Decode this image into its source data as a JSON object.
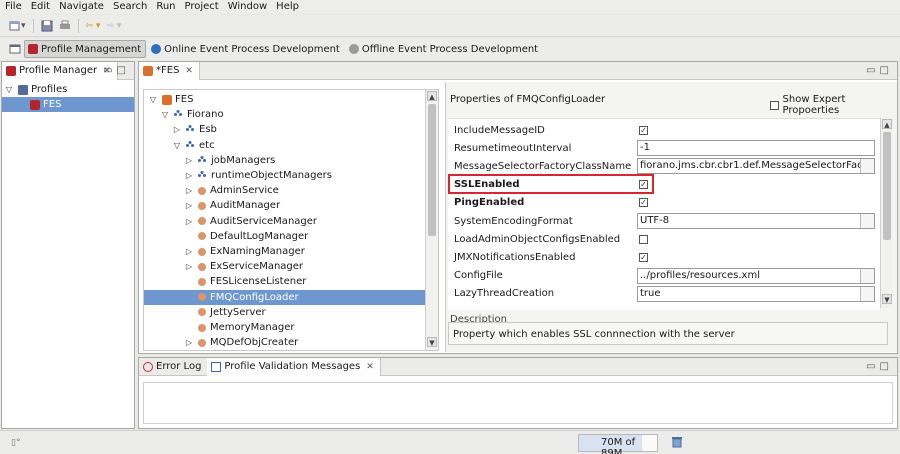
{
  "menu": [
    "File",
    "Edit",
    "Navigate",
    "Search",
    "Run",
    "Project",
    "Window",
    "Help"
  ],
  "perspectives": [
    {
      "label": "Profile Management",
      "active": true
    },
    {
      "label": "Online Event Process Development",
      "active": false
    },
    {
      "label": "Offline Event Process Development",
      "active": false
    }
  ],
  "profile_manager": {
    "tab_label": "Profile Manager",
    "tree": [
      {
        "label": "Profiles",
        "expanded": true
      },
      {
        "label": "FES",
        "selected": true
      }
    ]
  },
  "editor": {
    "tab_label": "*FES",
    "tree": [
      {
        "label": "FES",
        "depth": 0,
        "twisty": "open"
      },
      {
        "label": "Fiorano",
        "depth": 1,
        "twisty": "open"
      },
      {
        "label": "Esb",
        "depth": 2,
        "twisty": "closed"
      },
      {
        "label": "etc",
        "depth": 2,
        "twisty": "open"
      },
      {
        "label": "jobManagers",
        "depth": 3,
        "twisty": "closed",
        "icon": "pkg"
      },
      {
        "label": "runtimeObjectManagers",
        "depth": 3,
        "twisty": "closed",
        "icon": "pkg"
      },
      {
        "label": "AdminService",
        "depth": 3,
        "twisty": "closed",
        "icon": "dot"
      },
      {
        "label": "AuditManager",
        "depth": 3,
        "twisty": "closed",
        "icon": "dot"
      },
      {
        "label": "AuditServiceManager",
        "depth": 3,
        "twisty": "closed",
        "icon": "dot"
      },
      {
        "label": "DefaultLogManager",
        "depth": 3,
        "twisty": "none",
        "icon": "dot"
      },
      {
        "label": "ExNamingManager",
        "depth": 3,
        "twisty": "closed",
        "icon": "dot"
      },
      {
        "label": "ExServiceManager",
        "depth": 3,
        "twisty": "closed",
        "icon": "dot"
      },
      {
        "label": "FESLicenseListener",
        "depth": 3,
        "twisty": "none",
        "icon": "dot"
      },
      {
        "label": "FMQConfigLoader",
        "depth": 3,
        "twisty": "none",
        "icon": "dot",
        "selected": true
      },
      {
        "label": "JettyServer",
        "depth": 3,
        "twisty": "none",
        "icon": "dot"
      },
      {
        "label": "MemoryManager",
        "depth": 3,
        "twisty": "none",
        "icon": "dot"
      },
      {
        "label": "MQDefObjCreater",
        "depth": 3,
        "twisty": "closed",
        "icon": "dot"
      }
    ]
  },
  "properties": {
    "title": "Properties of FMQConfigLoader",
    "expert_label": "Show Expert Propoerties",
    "rows": [
      {
        "name": "IncludeMessageID",
        "type": "checkbox",
        "checked": true,
        "bold": false
      },
      {
        "name": "ResumetimeoutInterval",
        "type": "text",
        "value": "-1",
        "bold": false
      },
      {
        "name": "MessageSelectorFactoryClassName",
        "type": "text",
        "value": "fiorano.jms.cbr.cbr1.def.MessageSelectorFactory",
        "bold": false
      },
      {
        "name": "SSLEnabled",
        "type": "checkbox",
        "checked": true,
        "bold": true,
        "highlight": true
      },
      {
        "name": "PingEnabled",
        "type": "checkbox",
        "checked": true,
        "bold": true
      },
      {
        "name": "SystemEncodingFormat",
        "type": "text",
        "value": "UTF-8",
        "bold": false
      },
      {
        "name": "LoadAdminObjectConfigsEnabled",
        "type": "checkbox",
        "checked": false,
        "bold": false
      },
      {
        "name": "JMXNotificationsEnabled",
        "type": "checkbox",
        "checked": true,
        "bold": false
      },
      {
        "name": "ConfigFile",
        "type": "text",
        "value": "../profiles/resources.xml",
        "bold": false
      },
      {
        "name": "LazyThreadCreation",
        "type": "text",
        "value": "true",
        "bold": false
      }
    ],
    "description_label": "Description",
    "description_text": "Property which enables SSL connnection with the server"
  },
  "bottom_tabs": {
    "error_log": "Error Log",
    "validation": "Profile Validation Messages"
  },
  "status": {
    "memory": "70M of 89M"
  },
  "colors": {
    "selection": "#6f97cf",
    "highlight_box": "#d7262e"
  }
}
